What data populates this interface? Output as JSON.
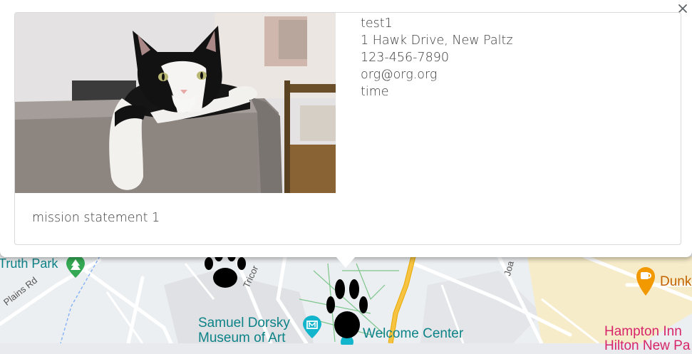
{
  "map": {
    "labels": {
      "truth_park": "Truth Park",
      "plains_rd": "Plains Rd",
      "tricor": "Tricor",
      "joa": "Joa",
      "museum_line1": "Samuel Dorsky",
      "museum_line2": "Museum of Art",
      "welcome_center": "Welcome Center",
      "dunk": "Dunk",
      "hampton_line1": "Hampton Inn",
      "hampton_line2": "Hilton New Pa"
    },
    "colors": {
      "poi_teal": "#0d8387",
      "hotel_pink": "#d6256a",
      "food_orange": "#f29900",
      "road_yellow": "#f6c343"
    },
    "icons": [
      "paw-icon",
      "park-tree-icon",
      "museum-icon",
      "coffee-icon"
    ]
  },
  "info": {
    "close_icon": "close-icon",
    "name": "test1",
    "address": "1 Hawk Drive, New Paltz",
    "phone": "123-456-7890",
    "email": "org@org.org",
    "time": "time",
    "mission": "mission statement 1",
    "photo_icon": "cat-photo"
  }
}
